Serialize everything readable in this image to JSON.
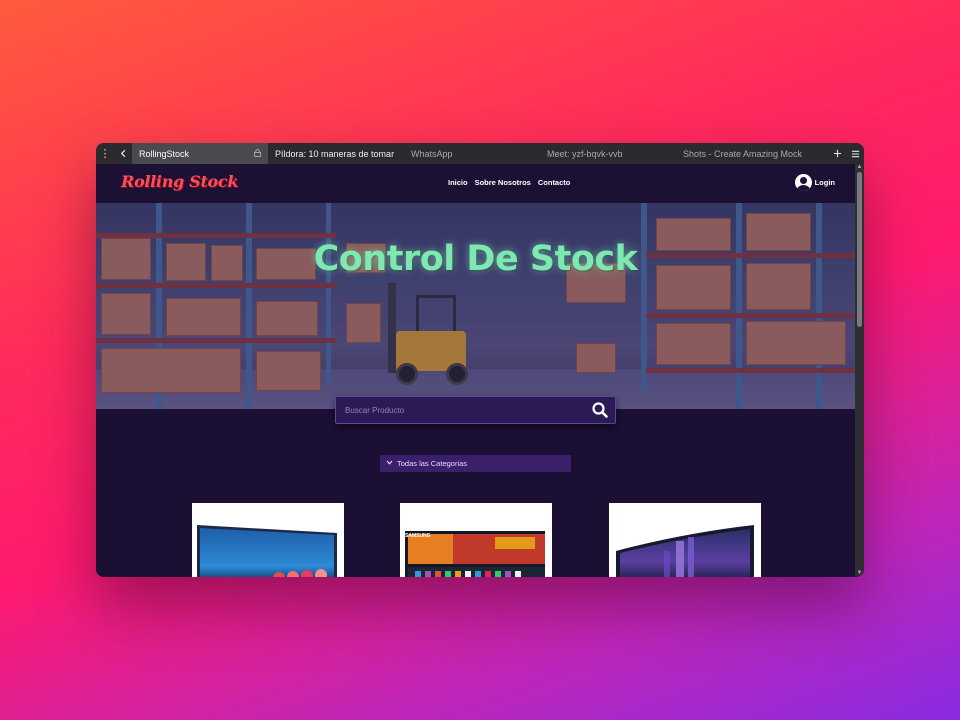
{
  "browser": {
    "tabs": [
      {
        "label": "RollingStock",
        "active": true
      },
      {
        "label": "Píldora: 10 maneras de tomar",
        "active": false
      },
      {
        "label": "WhatsApp",
        "active": false
      },
      {
        "label": "Meet: yzf-bqvk-vvb",
        "active": false
      },
      {
        "label": "Shots - Create Amazing Mock",
        "active": false
      }
    ],
    "icons": {
      "menu": "kebab-menu-icon",
      "back": "back-arrow-icon",
      "lock": "lock-icon",
      "new_tab": "plus-icon",
      "hamburger": "hamburger-icon"
    }
  },
  "site": {
    "logo": "Rolling Stock",
    "nav": [
      "Inicio",
      "Sobre Nosotros",
      "Contacto"
    ],
    "login_label": "Login"
  },
  "hero": {
    "title": "Control De Stock"
  },
  "search": {
    "placeholder": "Buscar Producto"
  },
  "filter": {
    "category_selected": "Todas las Categorias"
  },
  "products": [
    {
      "name": "monitor-1",
      "brand": ""
    },
    {
      "name": "monitor-2",
      "brand": "SAMSUNG"
    },
    {
      "name": "monitor-3",
      "brand": ""
    }
  ],
  "colors": {
    "page_bg": "#1b0f33",
    "logo": "#ff4d5a",
    "hero_title": "#7de8b0",
    "search_bg": "#2c1a55",
    "select_bg": "#3a1f6b"
  }
}
